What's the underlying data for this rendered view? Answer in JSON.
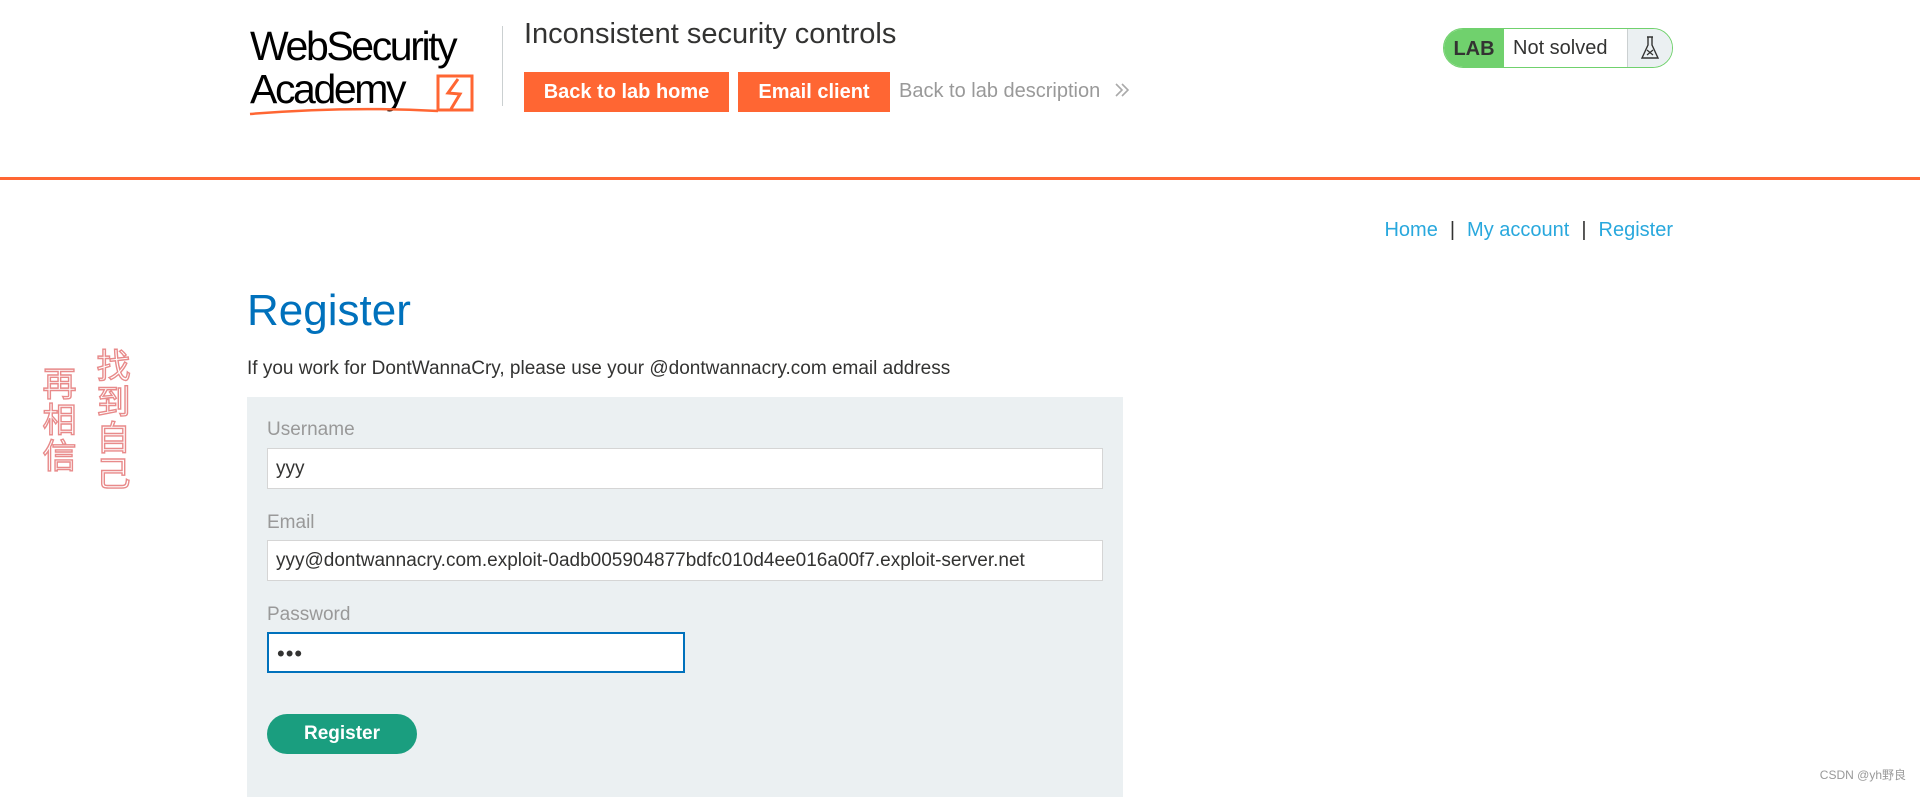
{
  "header": {
    "logo_line1": "WebSecurity",
    "logo_line2": "Academy",
    "lab_title": "Inconsistent security controls",
    "back_to_lab_home": "Back to lab home",
    "email_client": "Email client",
    "back_to_lab_description": "Back to lab description",
    "lab_badge": "LAB",
    "lab_status": "Not solved",
    "flask_icon": "flask-icon",
    "chevron_icon": "double-chevron-right-icon"
  },
  "nav": {
    "home": "Home",
    "my_account": "My account",
    "register": "Register",
    "separator": "|"
  },
  "main": {
    "title": "Register",
    "notice": "If you work for DontWannaCry, please use your @dontwannacry.com email address",
    "form": {
      "username_label": "Username",
      "username_value": "yyy",
      "email_label": "Email",
      "email_value": "yyy@dontwannacry.com.exploit-0adb005904877bdfc010d4ee016a00f7.exploit-server.net",
      "password_label": "Password",
      "password_value": "•••",
      "submit_label": "Register"
    }
  },
  "watermark": {
    "left": "再相信",
    "right": "找到自己",
    "csdn": "CSDN @yh野良"
  },
  "colors": {
    "accent": "#ff6633",
    "title_blue": "#0071bc",
    "link_blue": "#29a8dd",
    "lab_green": "#70d16d",
    "register_green": "#1a9e7f",
    "panel_bg": "#ebf0f2"
  }
}
